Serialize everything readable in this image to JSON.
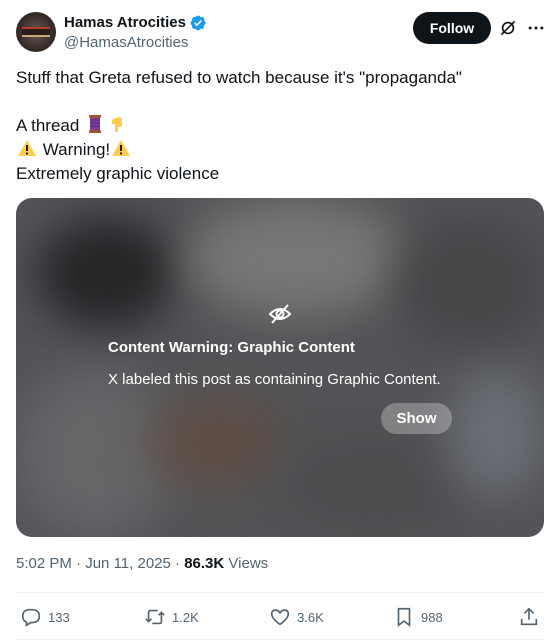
{
  "author": {
    "display_name": "Hamas Atrocities",
    "handle": "@HamasAtrocities",
    "verified_icon": "verified-badge-icon"
  },
  "header": {
    "follow_label": "Follow"
  },
  "tweet": {
    "line1": "Stuff that Greta refused to watch because it's \"propaganda\"",
    "line2_text": "A thread",
    "line3_text": "Warning!",
    "line4": "Extremely graphic violence"
  },
  "media": {
    "warning_title": "Content Warning: Graphic Content",
    "warning_text": "X labeled this post as containing Graphic Content.",
    "show_label": "Show"
  },
  "meta": {
    "time": "5:02 PM",
    "separator": "·",
    "date": "Jun 11, 2025",
    "views_count": "86.3K",
    "views_label": "Views"
  },
  "actions": {
    "replies": "133",
    "reposts": "1.2K",
    "likes": "3.6K",
    "bookmarks": "988"
  },
  "colors": {
    "text": "#0f1419",
    "secondary": "#536471",
    "verified": "#1d9bf0",
    "button_dark": "#0f1419",
    "divider": "#eff3f4"
  }
}
